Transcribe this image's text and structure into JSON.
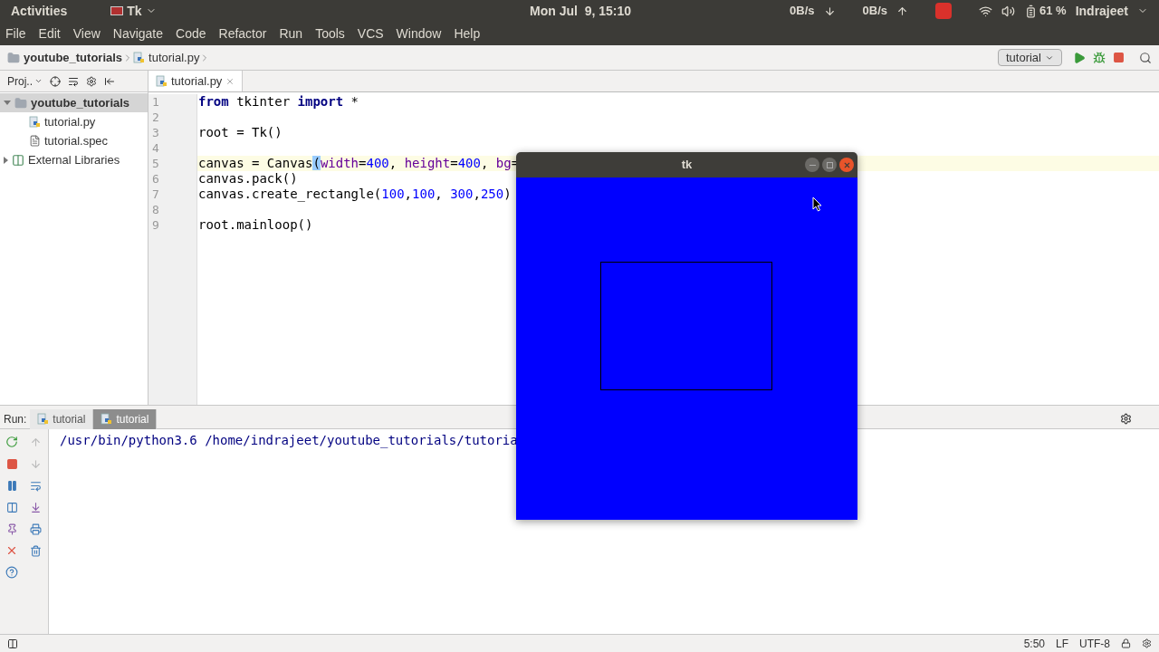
{
  "top_bar": {
    "activities": "Activities",
    "app_name": "Tk",
    "clock": "Mon Jul  9, 15:10",
    "net_down": "0B/s",
    "net_up": "0B/s",
    "battery": "61 %",
    "user": "Indrajeet"
  },
  "menu": [
    "File",
    "Edit",
    "View",
    "Navigate",
    "Code",
    "Refactor",
    "Run",
    "Tools",
    "VCS",
    "Window",
    "Help"
  ],
  "breadcrumb": [
    "youtube_tutorials",
    "tutorial.py"
  ],
  "run_config": "tutorial",
  "project_panel": {
    "title": "Proj..",
    "tree": [
      {
        "label": "youtube_tutorials",
        "kind": "folder",
        "expanded": true,
        "selected": true,
        "children": [
          {
            "label": "tutorial.py",
            "kind": "python",
            "selected": false
          },
          {
            "label": "tutorial.spec",
            "kind": "file",
            "selected": false
          }
        ]
      },
      {
        "label": "External Libraries",
        "kind": "library",
        "expanded": false,
        "selected": false
      }
    ]
  },
  "editor_tabs": [
    {
      "label": "tutorial.py",
      "selected": true
    }
  ],
  "code": [
    {
      "number": "1",
      "current": false,
      "tokens": [
        {
          "kind": "keyword",
          "text": "from"
        },
        {
          "kind": "plain",
          "text": " tkinter "
        },
        {
          "kind": "keyword",
          "text": "import"
        },
        {
          "kind": "plain",
          "text": " *"
        }
      ]
    },
    {
      "number": "2",
      "current": false
    },
    {
      "number": "3",
      "current": false,
      "tokens": [
        {
          "kind": "plain",
          "text": "root = Tk()"
        }
      ]
    },
    {
      "number": "4",
      "current": false
    },
    {
      "number": "5",
      "current": true,
      "tokens": [
        {
          "kind": "plain",
          "text": "canvas = Canvas"
        },
        {
          "kind": "bracket",
          "text": "("
        },
        {
          "kind": "param",
          "text": "width"
        },
        {
          "kind": "plain",
          "text": "="
        },
        {
          "kind": "number",
          "text": "400"
        },
        {
          "kind": "plain",
          "text": ", "
        },
        {
          "kind": "param",
          "text": "height"
        },
        {
          "kind": "plain",
          "text": "="
        },
        {
          "kind": "number",
          "text": "400"
        },
        {
          "kind": "plain",
          "text": ", "
        },
        {
          "kind": "param",
          "text": "bg"
        },
        {
          "kind": "plain",
          "text": "="
        }
      ]
    },
    {
      "number": "6",
      "current": false,
      "tokens": [
        {
          "kind": "plain",
          "text": "canvas.pack()"
        }
      ]
    },
    {
      "number": "7",
      "current": false,
      "tokens": [
        {
          "kind": "plain",
          "text": "canvas.create_rectangle("
        },
        {
          "kind": "number",
          "text": "100"
        },
        {
          "kind": "plain",
          "text": ","
        },
        {
          "kind": "number",
          "text": "100"
        },
        {
          "kind": "plain",
          "text": ", "
        },
        {
          "kind": "number",
          "text": "300"
        },
        {
          "kind": "plain",
          "text": ","
        },
        {
          "kind": "number",
          "text": "250"
        },
        {
          "kind": "plain",
          "text": ")"
        }
      ]
    },
    {
      "number": "8",
      "current": false
    },
    {
      "number": "9",
      "current": false,
      "tokens": [
        {
          "kind": "plain",
          "text": "root.mainloop()"
        }
      ]
    }
  ],
  "run_panel": {
    "label": "Run:",
    "tabs": [
      {
        "label": "tutorial",
        "selected": false
      },
      {
        "label": "tutorial",
        "selected": true
      }
    ],
    "output": "/usr/bin/python3.6 /home/indrajeet/youtube_tutorials/tutoria"
  },
  "status_bar": {
    "position": "5:50",
    "line_ending": "LF",
    "encoding": "UTF-8"
  },
  "tk_window": {
    "title": "tk"
  }
}
